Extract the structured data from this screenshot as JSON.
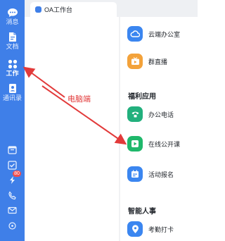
{
  "sidebar": {
    "items": [
      {
        "label": "消息",
        "icon": "chat-bubble-icon"
      },
      {
        "label": "文档",
        "icon": "document-icon"
      },
      {
        "label": "工作",
        "icon": "grid-apps-icon",
        "active": true
      },
      {
        "label": "通讯录",
        "icon": "contacts-icon"
      }
    ],
    "bottom_icons": [
      "calendar-icon",
      "todo-check-icon",
      "ding-icon",
      "phone-icon",
      "mail-icon",
      "more-icon"
    ],
    "badge_count": "80"
  },
  "tab": {
    "title": "OA工作台"
  },
  "list": {
    "top_items": [
      {
        "label": "云端办公室",
        "icon": "cloud-office-icon",
        "color": "#3b86f0"
      },
      {
        "label": "群直播",
        "icon": "live-tv-icon",
        "color": "#f3a23a"
      }
    ],
    "sections": [
      {
        "title": "福利应用",
        "items": [
          {
            "label": "办公电话",
            "icon": "phone-icon",
            "color": "#22b07d"
          },
          {
            "label": "在线公开课",
            "icon": "play-icon",
            "color": "#1fb86b"
          },
          {
            "label": "活动报名",
            "icon": "calendar-signup-icon",
            "color": "#3b86f0"
          }
        ]
      },
      {
        "title": "智能人事",
        "items": [
          {
            "label": "考勤打卡",
            "icon": "location-pin-icon",
            "color": "#3b86f0"
          }
        ]
      }
    ]
  },
  "annotation": {
    "label": "电脑端",
    "color": "#e23a3a"
  },
  "colors": {
    "rail": "#3f7fe8",
    "accent_red": "#e23a3a"
  }
}
